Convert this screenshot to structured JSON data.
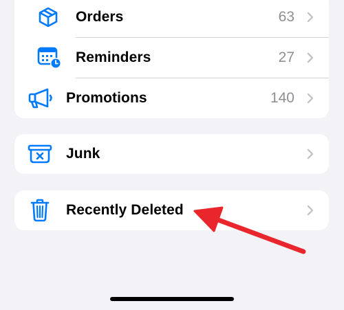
{
  "mailboxes": {
    "orders": {
      "label": "Orders",
      "count": "63"
    },
    "reminders": {
      "label": "Reminders",
      "count": "27"
    },
    "promotions": {
      "label": "Promotions",
      "count": "140"
    },
    "junk": {
      "label": "Junk"
    },
    "recently_deleted": {
      "label": "Recently Deleted"
    }
  },
  "colors": {
    "accent": "#007aff",
    "annotation_arrow": "#e8262b",
    "background": "#f2f2f7",
    "secondary_text": "#8e8e93"
  },
  "icons": {
    "orders": "package-icon",
    "reminders": "calendar-clock-icon",
    "promotions": "megaphone-icon",
    "junk": "junk-bin-icon",
    "recently_deleted": "trash-icon",
    "disclosure": "chevron-right-icon"
  }
}
